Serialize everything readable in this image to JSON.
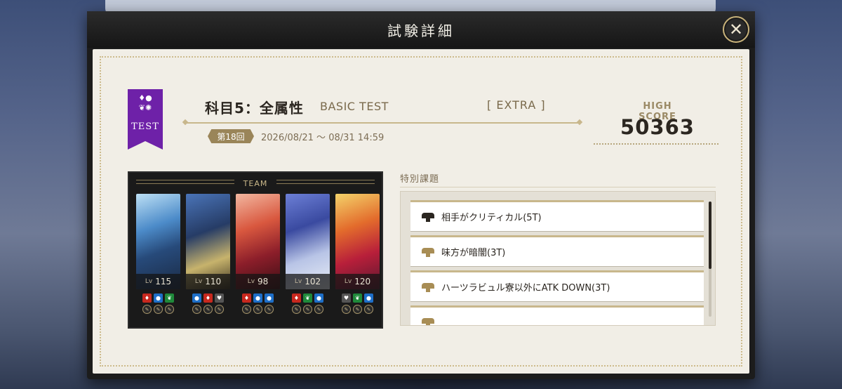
{
  "dialog": {
    "title": "試験詳細",
    "close_label": "✕"
  },
  "ribbon": {
    "text": "TEST"
  },
  "exam": {
    "subject": "科目5：全属性",
    "subtitle": "BASIC TEST",
    "difficulty": "[ EXTRA ]",
    "round": "第18回",
    "period": "2026/08/21 ～ 08/31 14:59"
  },
  "high_score": {
    "label": "HIGH SCORE",
    "value": "50363"
  },
  "team": {
    "label": "TEAM",
    "lv_prefix": "Lv",
    "members": [
      {
        "level": "115",
        "art": "icy-blue"
      },
      {
        "level": "110",
        "art": "blue-gold"
      },
      {
        "level": "98",
        "art": "red-pink"
      },
      {
        "level": "102",
        "art": "violet-blue"
      },
      {
        "level": "120",
        "art": "red-orange"
      }
    ]
  },
  "special_tasks": {
    "label": "特別課題",
    "items": [
      {
        "text": "相手がクリティカル(5T)",
        "icon_color": "#2b2620"
      },
      {
        "text": "味方が暗闇(3T)",
        "icon_color": "#a88d55"
      },
      {
        "text": "ハーツラビュル寮以外にATK DOWN(3T)",
        "icon_color": "#a88d55"
      }
    ]
  },
  "colors": {
    "accent_gold": "#c8b78c",
    "ribbon_purple": "#6e21a8",
    "fire": "#c8281e",
    "water": "#1e6fc8",
    "flora": "#1f8a3a",
    "cosmic": "#555555"
  }
}
